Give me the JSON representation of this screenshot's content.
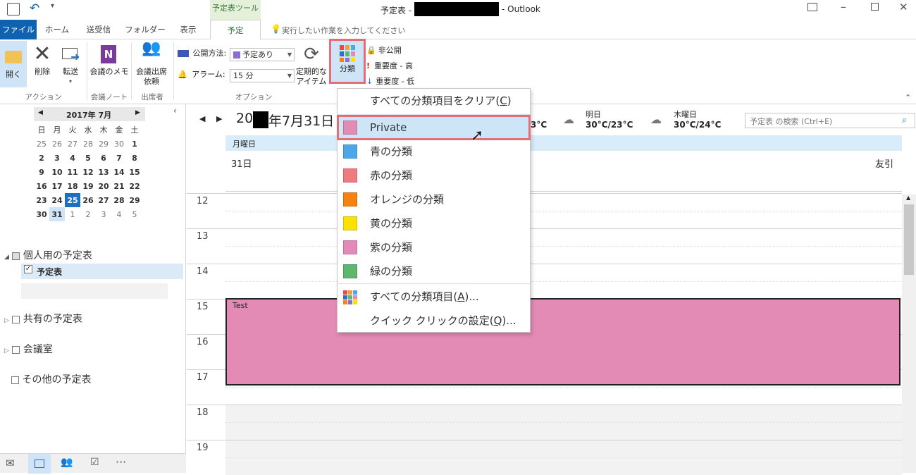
{
  "window": {
    "title_prefix": "予定表 - ",
    "title_suffix": "- Outlook",
    "context_tab": "予定表ツール"
  },
  "tabs": [
    {
      "label": "ファイル"
    },
    {
      "label": "ホーム"
    },
    {
      "label": "送受信"
    },
    {
      "label": "フォルダー"
    },
    {
      "label": "表示"
    },
    {
      "label": "予定"
    }
  ],
  "tell_me": "実行したい作業を入力してください",
  "ribbon": {
    "open": "開く",
    "delete": "削除",
    "forward": "転送",
    "meeting_notes": "会議のメモ",
    "meeting_response_1": "会議出席",
    "meeting_response_2": "依頼",
    "group_actions": "アクション",
    "group_notes": "会議ノート",
    "group_attendees": "出席者",
    "show_as_label": "公開方法:",
    "show_as_value": "予定あり",
    "reminder_label": "アラーム:",
    "reminder_value": "15 分",
    "recurrence_1": "定期的な",
    "recurrence_2": "アイテム",
    "categorize": "分類",
    "private": "非公開",
    "importance_high": "重要度 - 高",
    "importance_low": "重要度 - 低",
    "group_options": "オプション"
  },
  "minical": {
    "title": "2017年 7月",
    "weekdays": [
      "日",
      "月",
      "火",
      "水",
      "木",
      "金",
      "土"
    ],
    "weeks": [
      [
        "25",
        "26",
        "27",
        "28",
        "29",
        "30",
        "1"
      ],
      [
        "2",
        "3",
        "4",
        "5",
        "6",
        "7",
        "8"
      ],
      [
        "9",
        "10",
        "11",
        "12",
        "13",
        "14",
        "15"
      ],
      [
        "16",
        "17",
        "18",
        "19",
        "20",
        "21",
        "22"
      ],
      [
        "23",
        "24",
        "25",
        "26",
        "27",
        "28",
        "29"
      ],
      [
        "30",
        "31",
        "1",
        "2",
        "3",
        "4",
        "5"
      ]
    ]
  },
  "folders": {
    "personal": "個人用の予定表",
    "calendar": "予定表",
    "shared": "共有の予定表",
    "rooms": "会議室",
    "other": "その他の予定表"
  },
  "calendar": {
    "date_prefix": "20",
    "date_suffix": "年7月31日",
    "weather_today_temp": "3°C",
    "weather_tomorrow_label": "明日",
    "weather_tomorrow_temp": "30°C/23°C",
    "weather_thu_label": "木曜日",
    "weather_thu_temp": "30°C/24°C",
    "search_placeholder": "予定表 の検索 (Ctrl+E)",
    "day_name": "月曜日",
    "day_number": "31日",
    "rokuyo": "友引",
    "hours": [
      "12",
      "13",
      "14",
      "15",
      "16",
      "17",
      "18",
      "19"
    ],
    "event_title": "Test",
    "event_color": "#e38ab5"
  },
  "menu": {
    "clear_all": "すべての分類項目をクリア(",
    "clear_all_key": "C",
    "clear_all_end": ")",
    "items": [
      {
        "label": "Private",
        "color": "#e38ab5"
      },
      {
        "label": "青の分類",
        "color": "#4ba7e8"
      },
      {
        "label": "赤の分類",
        "color": "#ef7b81"
      },
      {
        "label": "オレンジの分類",
        "color": "#f7830f"
      },
      {
        "label": "黄の分類",
        "color": "#fbe200"
      },
      {
        "label": "紫の分類",
        "color": "#e48ab8"
      },
      {
        "label": "緑の分類",
        "color": "#5fb76e"
      }
    ],
    "all_categories": "すべての分類項目(",
    "all_categories_key": "A",
    "all_categories_end": ")...",
    "quick_click": "クイック クリックの設定(",
    "quick_click_key": "Q",
    "quick_click_end": ")..."
  }
}
